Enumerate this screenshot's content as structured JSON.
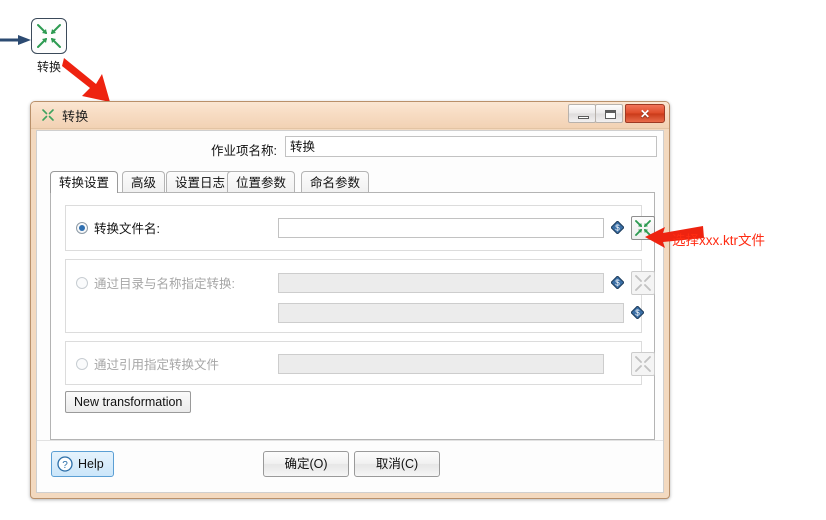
{
  "canvas": {
    "node": {
      "label": "转换",
      "icon": "transformation-converge-icon"
    },
    "annotations": {
      "arrow_to_node": "blue-hop-arrow",
      "arrow_to_dialog": "red-arrow-down-right",
      "arrow_to_browse": "red-arrow-left",
      "browse_note": "选择xxx.ktr文件"
    }
  },
  "dialog": {
    "title": "转换",
    "title_icon": "transformation-converge-icon",
    "window_buttons": {
      "minimize": "minimize-icon",
      "maximize": "maximize-icon",
      "close": "✕"
    },
    "job_entry_name": {
      "label": "作业项名称:",
      "value": "转换",
      "placeholder": ""
    },
    "tabs": [
      {
        "label": "转换设置",
        "active": true
      },
      {
        "label": "高级",
        "active": false
      },
      {
        "label": "设置日志",
        "active": false
      },
      {
        "label": "位置参数",
        "active": false
      },
      {
        "label": "命名参数",
        "active": false
      }
    ],
    "options": [
      {
        "id": "by-filename",
        "label": "转换文件名:",
        "selected": true,
        "enabled": true,
        "field_value": "",
        "has_variable_icon": true,
        "browse_button": "transformation-browse-icon"
      },
      {
        "id": "by-directory-and-name",
        "label": "通过目录与名称指定转换:",
        "selected": false,
        "enabled": false,
        "field_value": "",
        "field2_value": "",
        "has_variable_icon": true,
        "browse_button": "transformation-browse-icon"
      },
      {
        "id": "by-reference",
        "label": "通过引用指定转换文件",
        "selected": false,
        "enabled": false,
        "field_value": "",
        "has_variable_icon": false,
        "browse_button": "transformation-browse-icon"
      }
    ],
    "new_transformation_button": "New transformation",
    "footer": {
      "help": "Help",
      "ok": "确定(O)",
      "cancel": "取消(C)"
    }
  },
  "colors": {
    "accent_green": "#2e9b52",
    "annotation_red": "#ff2b12",
    "title_bar": "#f7dcc3",
    "window_frame": "#f3d9bf",
    "close_button": "#de4c29",
    "radio_selected": "#2f6fb0",
    "help_highlight": "#5b9fd4"
  }
}
